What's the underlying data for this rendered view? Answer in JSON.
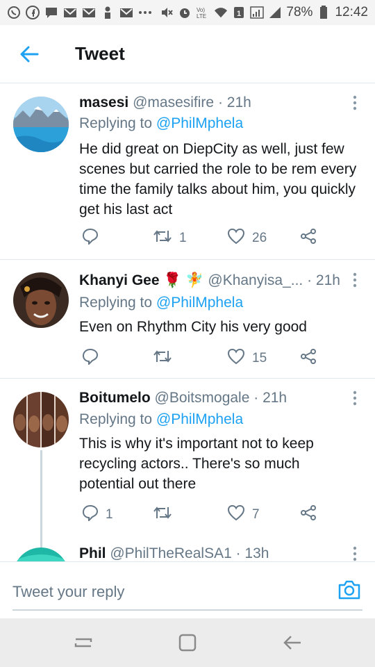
{
  "status_bar": {
    "battery_percent": "78%",
    "time": "12:42",
    "icons": [
      "whatsapp-icon",
      "facebook-icon",
      "message-icon",
      "gmail-icon",
      "gmail-icon",
      "person-icon",
      "gmail-icon",
      "more-dots-icon",
      "mute-icon",
      "alarm-icon",
      "volte-icon",
      "wifi-icon",
      "sim-icon",
      "signal-icon",
      "signal-icon",
      "battery-icon"
    ]
  },
  "header": {
    "title": "Tweet"
  },
  "tweets": [
    {
      "name": "masesi",
      "handle": "@masesifire",
      "time": "· 21h",
      "replying_prefix": "Replying to ",
      "replying_handle": "@PhilMphela",
      "text": "He did great on DiepCity as well, just few scenes but carried the role to be rem every time the family talks about him, you quickly get his last act",
      "reply_count": "",
      "retweet_count": "1",
      "like_count": "26"
    },
    {
      "name": "Khanyi Gee",
      "emoji": "🌹 🧚",
      "handle": "@Khanyisa_...",
      "time": "· 21h",
      "replying_prefix": "Replying to ",
      "replying_handle": "@PhilMphela",
      "text": "Even on Rhythm City his very good",
      "reply_count": "",
      "retweet_count": "",
      "like_count": "15"
    },
    {
      "name": "Boitumelo",
      "handle": "@Boitsmogale",
      "time": "· 21h",
      "replying_prefix": "Replying to ",
      "replying_handle": "@PhilMphela",
      "text": "This is why it's important not to keep recycling actors.. There's so much potential out there",
      "reply_count": "1",
      "retweet_count": "",
      "like_count": "7"
    },
    {
      "name": "Phil",
      "handle": "@PhilTheRealSA1",
      "time": "· 13h"
    }
  ],
  "reply_bar": {
    "placeholder": "Tweet your reply"
  },
  "colors": {
    "accent": "#1da1f2",
    "secondary_text": "#657786",
    "divider": "#e1e8ed"
  }
}
